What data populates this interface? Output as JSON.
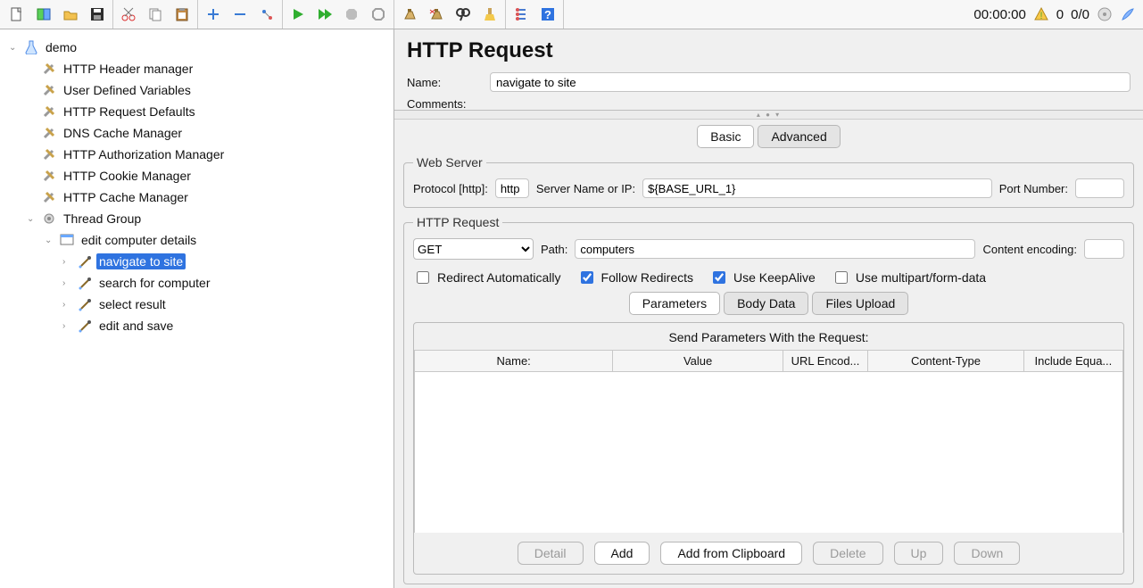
{
  "status": {
    "time": "00:00:00",
    "warn_count": "0",
    "ratio": "0/0"
  },
  "tree": {
    "plan": "demo",
    "cfg": [
      "HTTP Header manager",
      "User Defined Variables",
      "HTTP Request Defaults",
      "DNS Cache Manager",
      "HTTP Authorization Manager",
      "HTTP Cookie Manager",
      "HTTP Cache Manager"
    ],
    "thread_group": "Thread Group",
    "controller": "edit computer details",
    "samplers": [
      "navigate to site",
      "search for computer",
      "select result",
      "edit and save"
    ],
    "selected_sampler_index": 0
  },
  "panel": {
    "title": "HTTP Request",
    "name_label": "Name:",
    "name_value": "navigate to site",
    "comments_label": "Comments:",
    "tabs": {
      "basic": "Basic",
      "advanced": "Advanced"
    },
    "web": {
      "legend": "Web Server",
      "protocol_label": "Protocol [http]:",
      "protocol_value": "http",
      "server_label": "Server Name or IP:",
      "server_value": "${BASE_URL_1}",
      "port_label": "Port Number:",
      "port_value": ""
    },
    "req": {
      "legend": "HTTP Request",
      "method": "GET",
      "path_label": "Path:",
      "path_value": "computers",
      "enc_label": "Content encoding:",
      "enc_value": "",
      "chk": {
        "redirect_auto": {
          "label": "Redirect Automatically",
          "checked": false
        },
        "follow": {
          "label": "Follow Redirects",
          "checked": true
        },
        "keepalive": {
          "label": "Use KeepAlive",
          "checked": true
        },
        "multipart": {
          "label": "Use multipart/form-data",
          "checked": false
        }
      },
      "inner_tabs": {
        "params": "Parameters",
        "body": "Body Data",
        "files": "Files Upload"
      },
      "param_caption": "Send Parameters With the Request:",
      "cols": {
        "name": "Name:",
        "value": "Value",
        "enc": "URL Encod...",
        "ctype": "Content-Type",
        "inc": "Include Equa..."
      },
      "btns": {
        "detail": "Detail",
        "add": "Add",
        "clip": "Add from Clipboard",
        "del": "Delete",
        "up": "Up",
        "down": "Down"
      }
    }
  }
}
